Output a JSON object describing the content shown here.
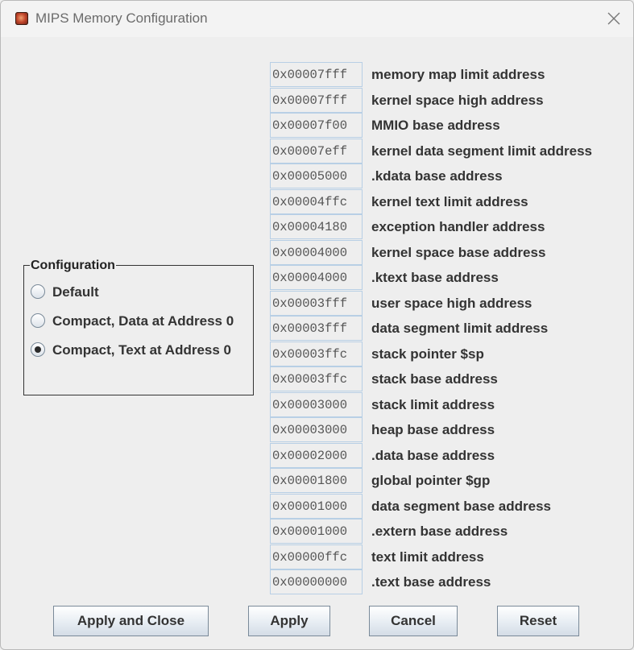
{
  "window": {
    "title": "MIPS Memory Configuration",
    "icon": "mars-app-icon"
  },
  "configuration": {
    "legend": "Configuration",
    "options": [
      {
        "label": "Default",
        "selected": false
      },
      {
        "label": "Compact, Data at Address 0",
        "selected": false
      },
      {
        "label": "Compact, Text at Address 0",
        "selected": true
      }
    ]
  },
  "addresses": [
    {
      "value": "0x00007fff",
      "label": "memory map limit address"
    },
    {
      "value": "0x00007fff",
      "label": "kernel space high address"
    },
    {
      "value": "0x00007f00",
      "label": "MMIO base address"
    },
    {
      "value": "0x00007eff",
      "label": "kernel data segment limit address"
    },
    {
      "value": "0x00005000",
      "label": ".kdata base address"
    },
    {
      "value": "0x00004ffc",
      "label": "kernel text limit address"
    },
    {
      "value": "0x00004180",
      "label": "exception handler address"
    },
    {
      "value": "0x00004000",
      "label": "kernel space base address"
    },
    {
      "value": "0x00004000",
      "label": ".ktext base address"
    },
    {
      "value": "0x00003fff",
      "label": "user space high address"
    },
    {
      "value": "0x00003fff",
      "label": "data segment limit address"
    },
    {
      "value": "0x00003ffc",
      "label": "stack pointer $sp"
    },
    {
      "value": "0x00003ffc",
      "label": "stack base address"
    },
    {
      "value": "0x00003000",
      "label": "stack limit address"
    },
    {
      "value": "0x00003000",
      "label": "heap base address"
    },
    {
      "value": "0x00002000",
      "label": ".data base address"
    },
    {
      "value": "0x00001800",
      "label": "global pointer $gp"
    },
    {
      "value": "0x00001000",
      "label": "data segment base address"
    },
    {
      "value": "0x00001000",
      "label": ".extern base address"
    },
    {
      "value": "0x00000ffc",
      "label": "text limit address"
    },
    {
      "value": "0x00000000",
      "label": ".text base address"
    }
  ],
  "buttons": {
    "apply_close": "Apply and Close",
    "apply": "Apply",
    "cancel": "Cancel",
    "reset": "Reset"
  },
  "colors": {
    "field_border": "#b8cfe5",
    "background": "#eeeeee"
  }
}
